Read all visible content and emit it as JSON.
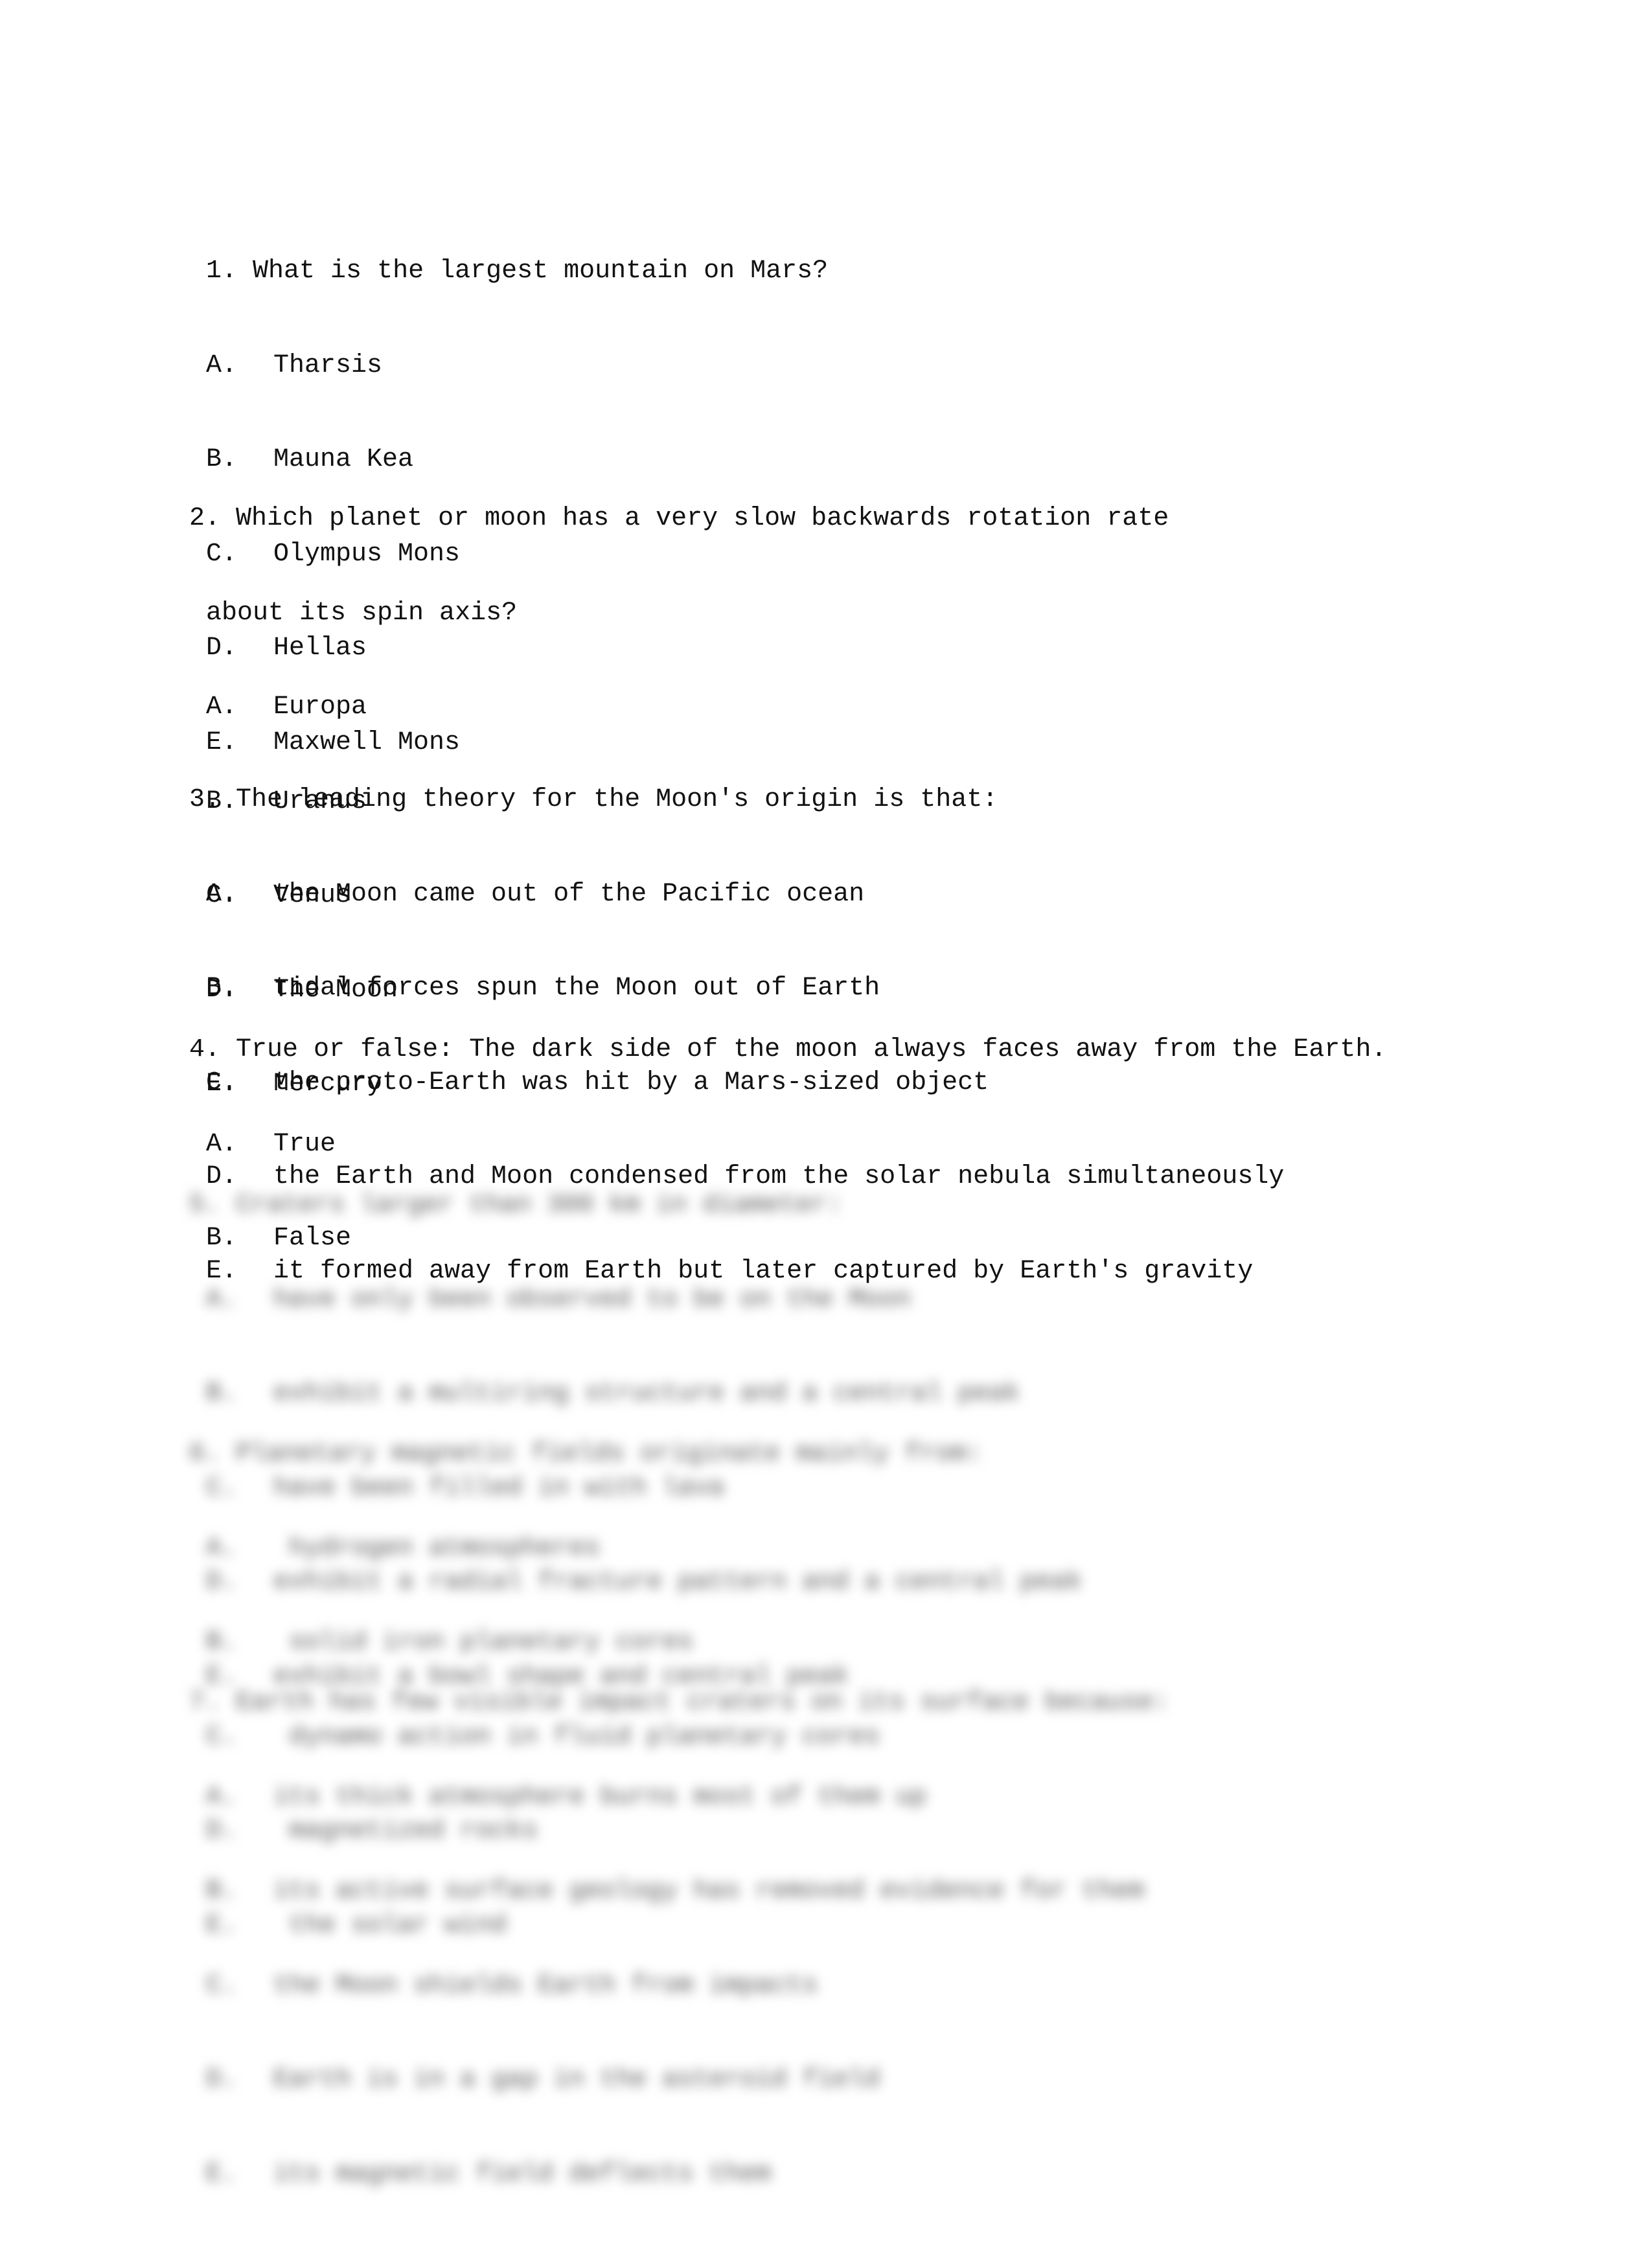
{
  "questions": [
    {
      "number": "1.",
      "text_lines": [
        "What is the largest mountain on Mars?"
      ],
      "options": [
        {
          "letter": "A.",
          "text": "Tharsis"
        },
        {
          "letter": "B.",
          "text": "Mauna Kea"
        },
        {
          "letter": "C.",
          "text": "Olympus Mons"
        },
        {
          "letter": "D.",
          "text": "Hellas"
        },
        {
          "letter": "E.",
          "text": "Maxwell Mons"
        }
      ]
    },
    {
      "number": "2.",
      "text_lines": [
        "Which planet or moon has a very slow backwards rotation rate",
        "about its spin axis?"
      ],
      "options": [
        {
          "letter": "A.",
          "text": "Europa"
        },
        {
          "letter": "B.",
          "text": "Uranus"
        },
        {
          "letter": "C.",
          "text": "Venus"
        },
        {
          "letter": "D.",
          "text": "The Moon"
        },
        {
          "letter": "E.",
          "text": "Mercury"
        }
      ]
    },
    {
      "number": "3.",
      "text_lines": [
        "The leading theory for the Moon's origin is that:"
      ],
      "options": [
        {
          "letter": "A.",
          "text": "the Moon came out of the Pacific ocean"
        },
        {
          "letter": "B.",
          "text": "tidal forces spun the Moon out of Earth"
        },
        {
          "letter": "C.",
          "text": "the proto-Earth was hit by a Mars-sized object"
        },
        {
          "letter": "D.",
          "text": "the Earth and Moon condensed from the solar nebula simultaneously"
        },
        {
          "letter": "E.",
          "text": "it formed away from Earth but later captured by Earth's gravity"
        }
      ]
    },
    {
      "number": "4.",
      "text_lines": [
        "True or false: The dark side of the moon always faces away from the Earth."
      ],
      "options": [
        {
          "letter": "A.",
          "text": "True"
        },
        {
          "letter": "B.",
          "text": "False"
        }
      ]
    },
    {
      "number": "5.",
      "blurred": true,
      "text_lines": [
        "Craters larger than 300 km in diameter:"
      ],
      "options": [
        {
          "letter": "A.",
          "text": "have only been observed to be on the Moon"
        },
        {
          "letter": "B.",
          "text": "exhibit a multiring structure and a central peak"
        },
        {
          "letter": "C.",
          "text": "have been filled in with lava"
        },
        {
          "letter": "D.",
          "text": "exhibit a radial fracture pattern and a central peak"
        },
        {
          "letter": "E.",
          "text": "exhibit a bowl shape and central peak"
        }
      ]
    },
    {
      "number": "6.",
      "blurred": true,
      "text_lines": [
        "Planetary magnetic fields originate mainly from:"
      ],
      "options": [
        {
          "letter": "A.",
          "text": " hydrogen atmospheres"
        },
        {
          "letter": "B.",
          "text": " solid iron planetary cores"
        },
        {
          "letter": "C.",
          "text": " dynamo action in fluid planetary cores"
        },
        {
          "letter": "D.",
          "text": " magnetized rocks"
        },
        {
          "letter": "E.",
          "text": " the solar wind"
        }
      ]
    },
    {
      "number": "7.",
      "blurred": true,
      "text_lines": [
        "Earth has few visible impact craters on its surface because:"
      ],
      "options": [
        {
          "letter": "A.",
          "text": "its thick atmosphere burns most of them up"
        },
        {
          "letter": "B.",
          "text": "its active surface geology has removed evidence for them"
        },
        {
          "letter": "C.",
          "text": "the Moon shields Earth from impacts"
        },
        {
          "letter": "D.",
          "text": "Earth is in a gap in the asteroid field"
        },
        {
          "letter": "E.",
          "text": "its magnetic field deflects them"
        }
      ]
    }
  ]
}
